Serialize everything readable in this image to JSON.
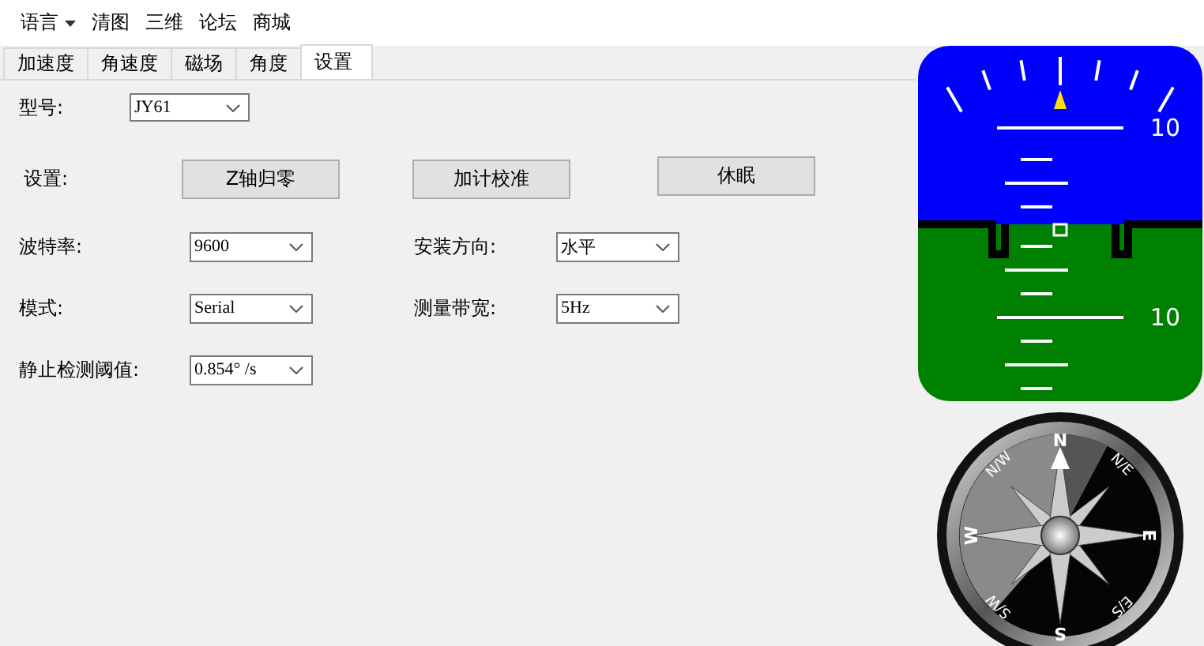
{
  "menu": [
    {
      "label": "语言",
      "kind": "dropdown"
    },
    {
      "label": "清图",
      "kind": "item"
    },
    {
      "label": "三维",
      "kind": "item"
    },
    {
      "label": "论坛",
      "kind": "item"
    },
    {
      "label": "商城",
      "kind": "item"
    }
  ],
  "tabs": [
    {
      "label": "加速度",
      "selected": false
    },
    {
      "label": "角速度",
      "selected": false
    },
    {
      "label": "磁场",
      "selected": false
    },
    {
      "label": "角度",
      "selected": false
    },
    {
      "label": "设置",
      "selected": true
    }
  ],
  "model": {
    "label": "型号:",
    "value": "JY61"
  },
  "settings": {
    "label": "设置:",
    "buttons": [
      "Z轴归零",
      "加计校准",
      "休眠"
    ]
  },
  "fields": [
    {
      "label": "波特率:",
      "value": "9600"
    },
    {
      "label": "安装方向:",
      "value": "水平"
    },
    {
      "label": "模式:",
      "value": "Serial"
    },
    {
      "label": "测量带宽:",
      "value": "5Hz"
    },
    {
      "label": "静止检测阈值:",
      "value": "0.854° /s"
    }
  ],
  "attitude_indicator": {
    "pitch_labels": [
      "10",
      "10"
    ]
  },
  "compass": {
    "labels": [
      "N",
      "N/E",
      "E",
      "E/S",
      "S",
      "S/W",
      "W",
      "N/W"
    ]
  }
}
